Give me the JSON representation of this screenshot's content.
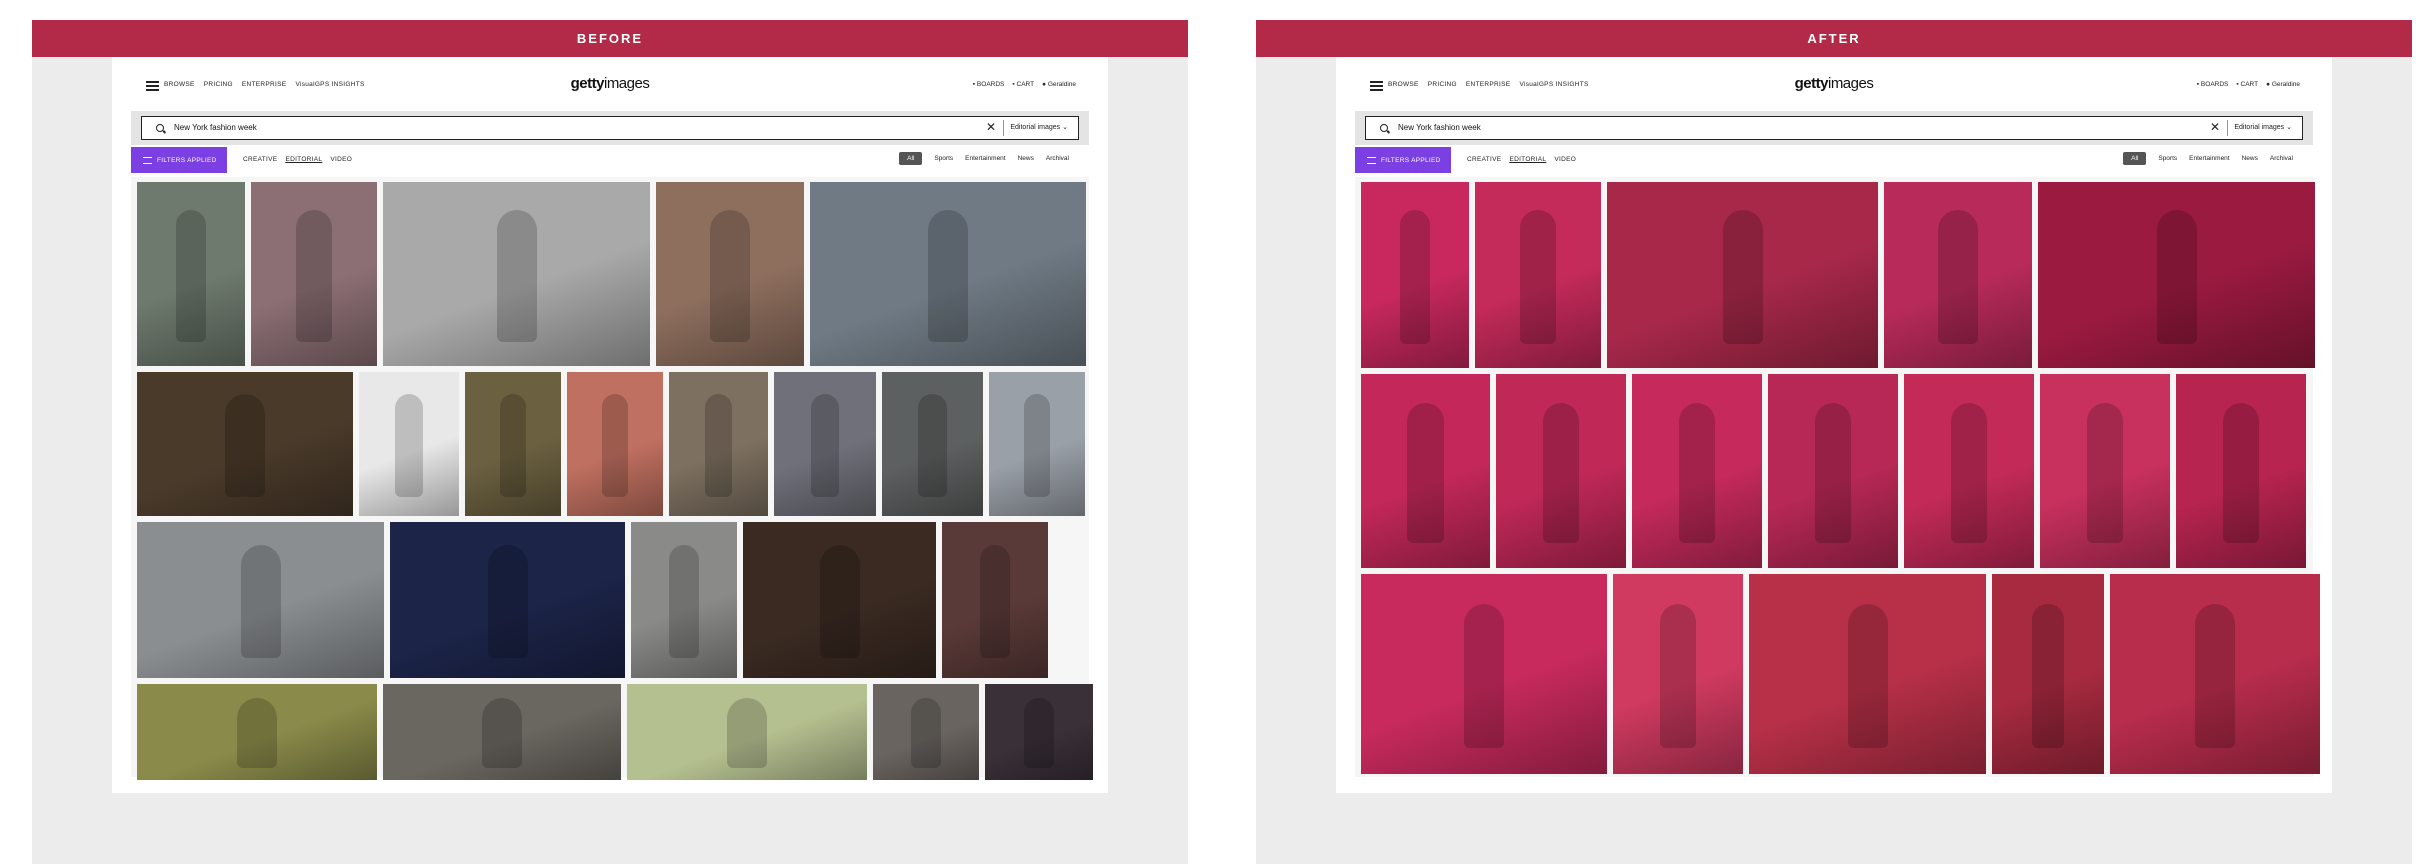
{
  "panels": [
    {
      "banner": "BEFORE",
      "nav": {
        "browse": "BROWSE",
        "pricing": "PRICING",
        "enterprise": "ENTERPRISE",
        "insights": "VisualGPS INSIGHTS",
        "logo_a": "getty",
        "logo_b": "images",
        "boards": "BOARDS",
        "cart": "CART",
        "user": "Geraldine"
      },
      "search": {
        "value": "New York fashion week",
        "dropdown": "Editorial images"
      },
      "filters": {
        "button": "FILTERS APPLIED",
        "creative": "CREATIVE",
        "editorial": "EDITORIAL",
        "video": "VIDEO"
      },
      "categories": [
        "All",
        "Sports",
        "Entertainment",
        "News",
        "Archival"
      ],
      "thumb_colors": [
        "#6e7a6e",
        "#8c6f74",
        "#a9a9a9",
        "#8e6f5e",
        "#6f7a84",
        "#4a3a2a",
        "#e8e8e8",
        "#6b6040",
        "#c07060",
        "#7d7060",
        "#70707a",
        "#5d6060",
        "#9aa0a8",
        "#8a8e90",
        "#1c2448",
        "#8a8a88",
        "#3a2a22",
        "#5a3a38",
        "#8a8a4a",
        "#6a6660",
        "#b5c090",
        "#6a6460",
        "#3a3038"
      ]
    },
    {
      "banner": "AFTER",
      "nav": {
        "browse": "BROWSE",
        "pricing": "PRICING",
        "enterprise": "ENTERPRISE",
        "insights": "VisualGPS INSIGHTS",
        "logo_a": "getty",
        "logo_b": "images",
        "boards": "BOARDS",
        "cart": "CART",
        "user": "Geraldine"
      },
      "search": {
        "value": "New York fashion week",
        "dropdown": "Editorial images"
      },
      "filters": {
        "button": "FILTERS APPLIED",
        "creative": "CREATIVE",
        "editorial": "EDITORIAL",
        "video": "VIDEO"
      },
      "categories": [
        "All",
        "Sports",
        "Entertainment",
        "News",
        "Archival"
      ],
      "thumb_colors": [
        "#c8285e",
        "#c42a5a",
        "#a8284a",
        "#b82a5a",
        "#9a1a40",
        "#c4285a",
        "#c02858",
        "#c62a5c",
        "#b82856",
        "#c42a58",
        "#c8305e",
        "#b82450",
        "#c82a5e",
        "#d03a60",
        "#b83048",
        "#a82a40",
        "#b82c4c"
      ]
    }
  ]
}
